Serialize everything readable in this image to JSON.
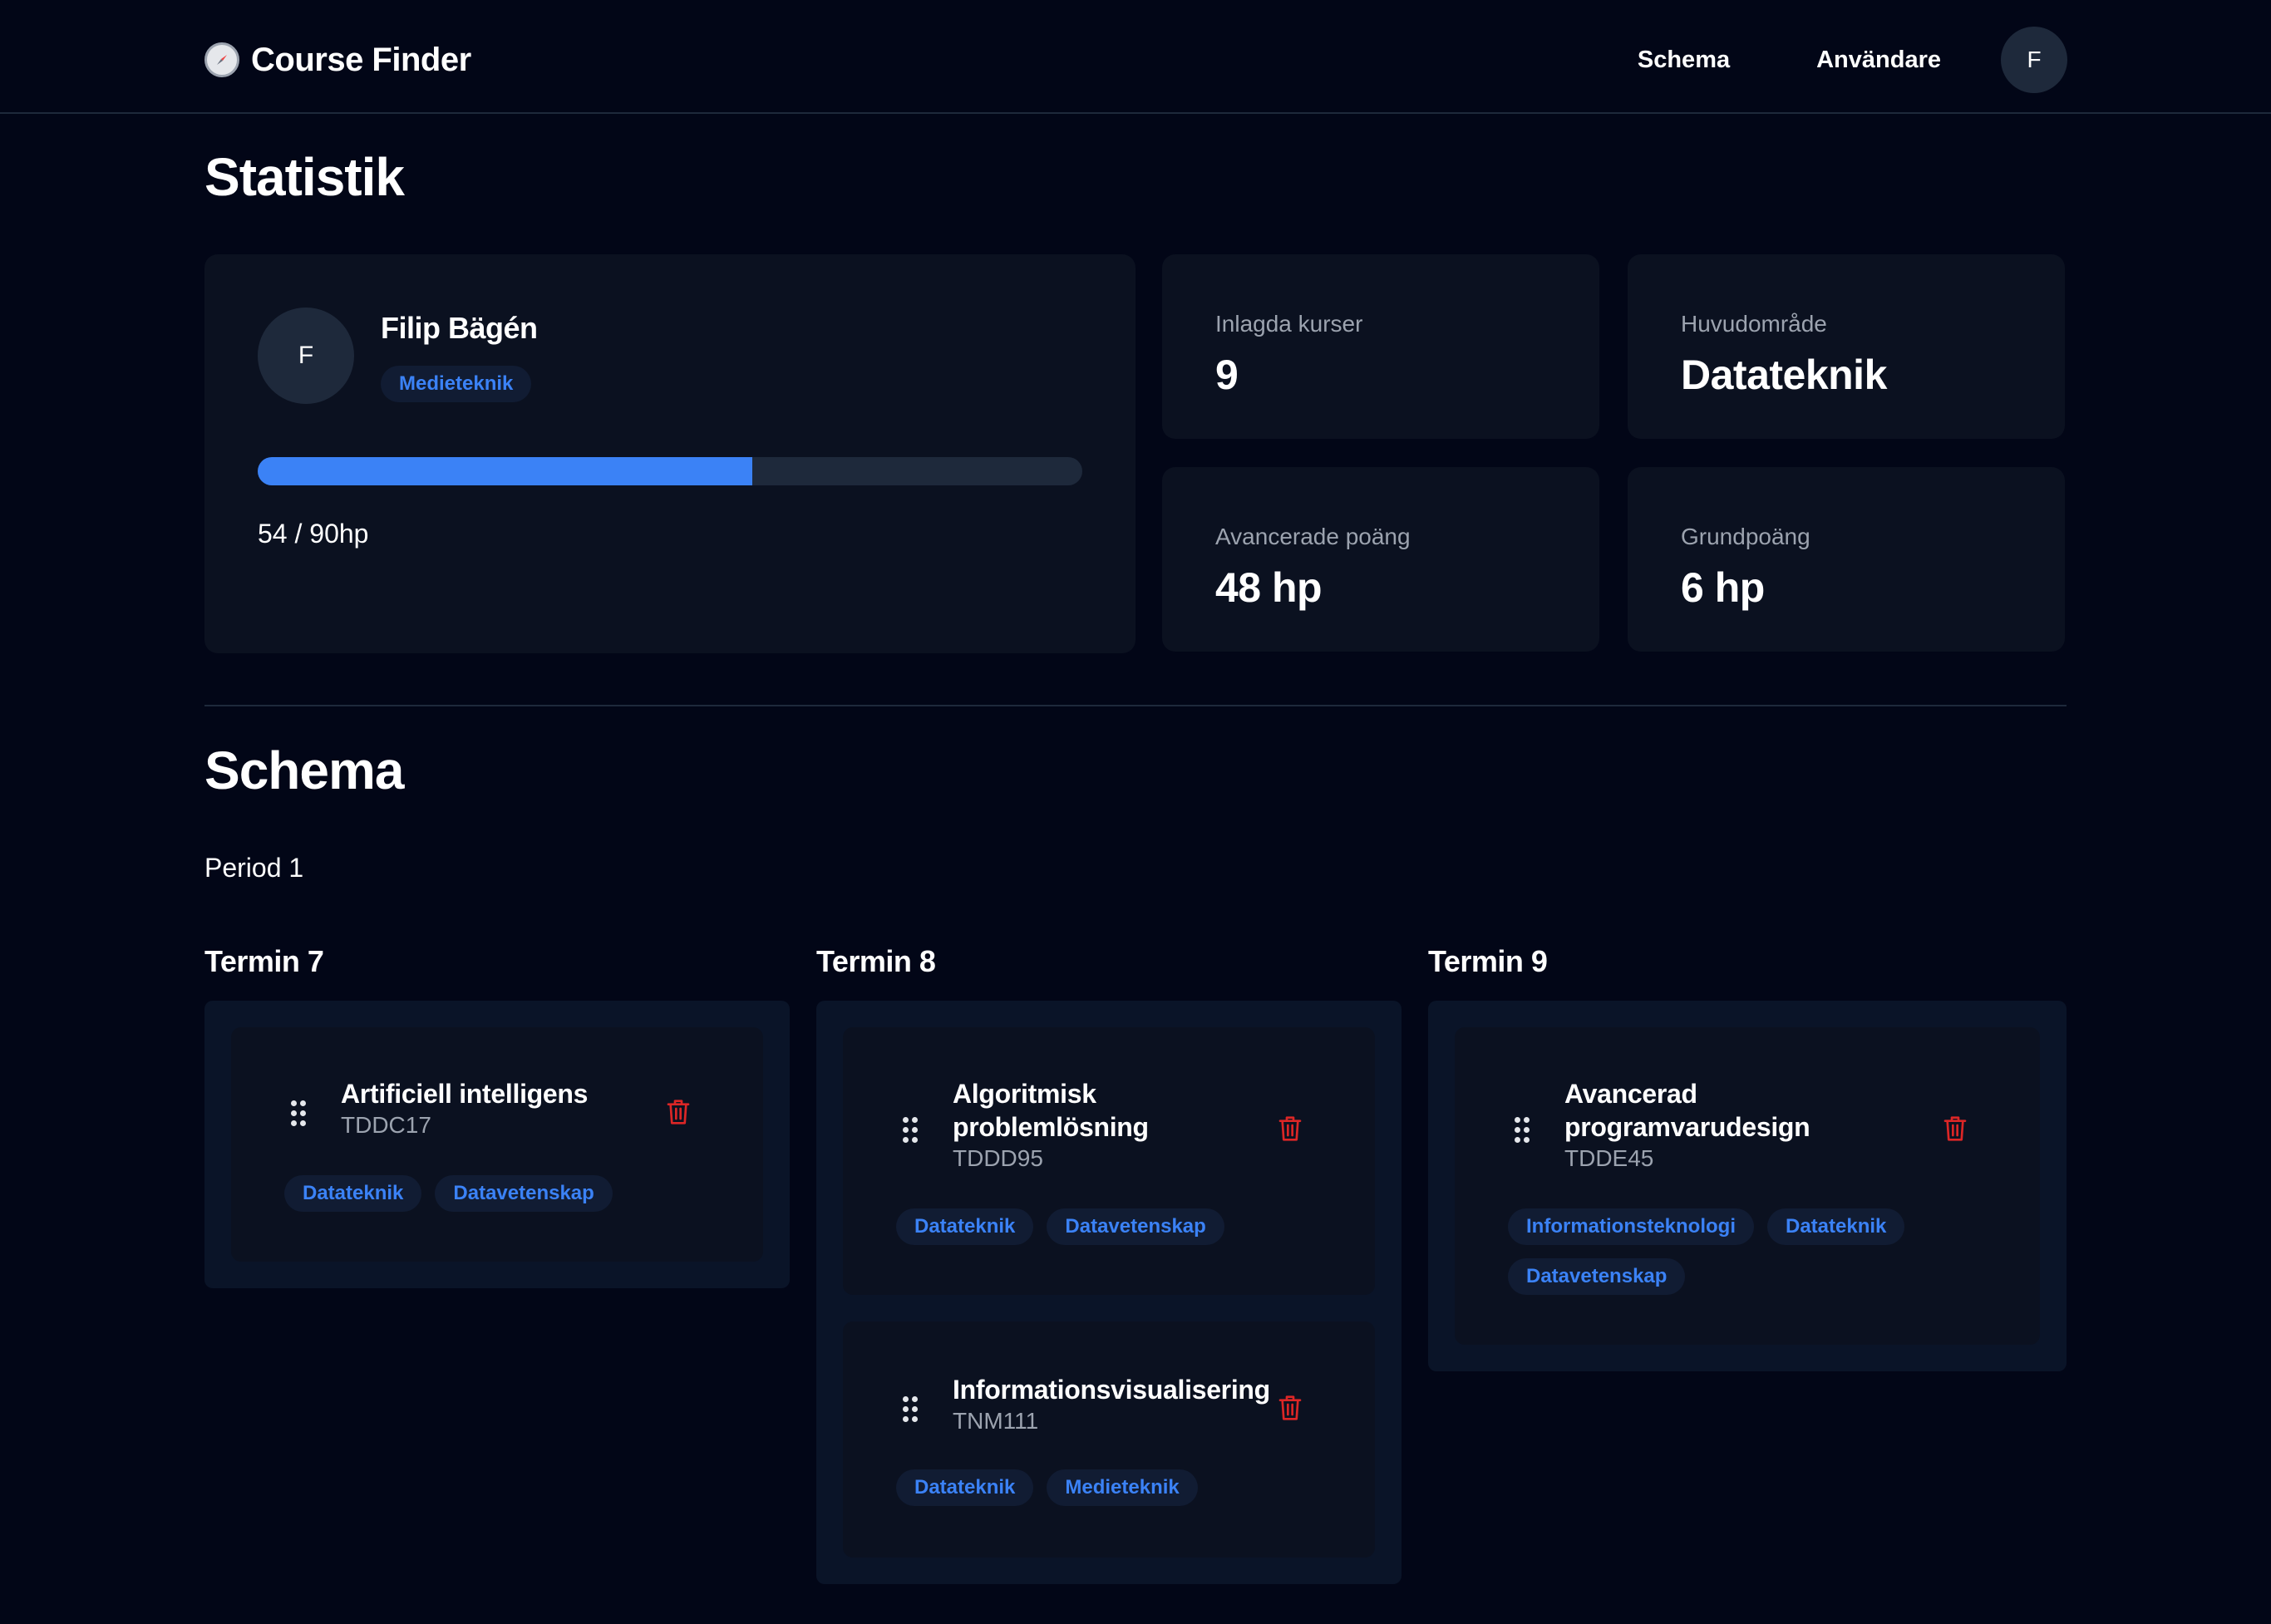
{
  "header": {
    "app_title": "Course Finder",
    "nav": [
      {
        "label": "Schema"
      },
      {
        "label": "Användare"
      }
    ],
    "avatar_initial": "F"
  },
  "stats": {
    "heading": "Statistik",
    "profile": {
      "initial": "F",
      "name": "Filip Bägén",
      "program": "Medieteknik",
      "progress_fraction": 0.6,
      "progress_label": "54 / 90hp"
    },
    "cards": [
      {
        "label": "Inlagda kurser",
        "value": "9"
      },
      {
        "label": "Huvudområde",
        "value": "Datateknik"
      },
      {
        "label": "Avancerade poäng",
        "value": "48 hp"
      },
      {
        "label": "Grundpoäng",
        "value": "6 hp"
      }
    ]
  },
  "schedule": {
    "heading": "Schema",
    "period": "Period 1",
    "terms": [
      {
        "title": "Termin 7",
        "courses": [
          {
            "name": "Artificiell intelligens",
            "code": "TDDC17",
            "tags": [
              "Datateknik",
              "Datavetenskap"
            ]
          }
        ]
      },
      {
        "title": "Termin 8",
        "courses": [
          {
            "name": "Algoritmisk problemlösning",
            "code": "TDDD95",
            "tags": [
              "Datateknik",
              "Datavetenskap"
            ]
          },
          {
            "name": "Informationsvisualisering",
            "code": "TNM111",
            "tags": [
              "Datateknik",
              "Medieteknik"
            ]
          }
        ]
      },
      {
        "title": "Termin 9",
        "courses": [
          {
            "name": "Avancerad programvarudesign",
            "code": "TDDE45",
            "tags": [
              "Informationsteknologi",
              "Datateknik",
              "Datavetenskap"
            ]
          }
        ]
      }
    ]
  },
  "colors": {
    "background": "#020617",
    "card": "#0b1120",
    "accent": "#3b82f6",
    "delete": "#dc2626"
  },
  "icons": {
    "brand": "compass-icon",
    "drag": "drag-handle-icon",
    "delete": "trash-icon"
  }
}
